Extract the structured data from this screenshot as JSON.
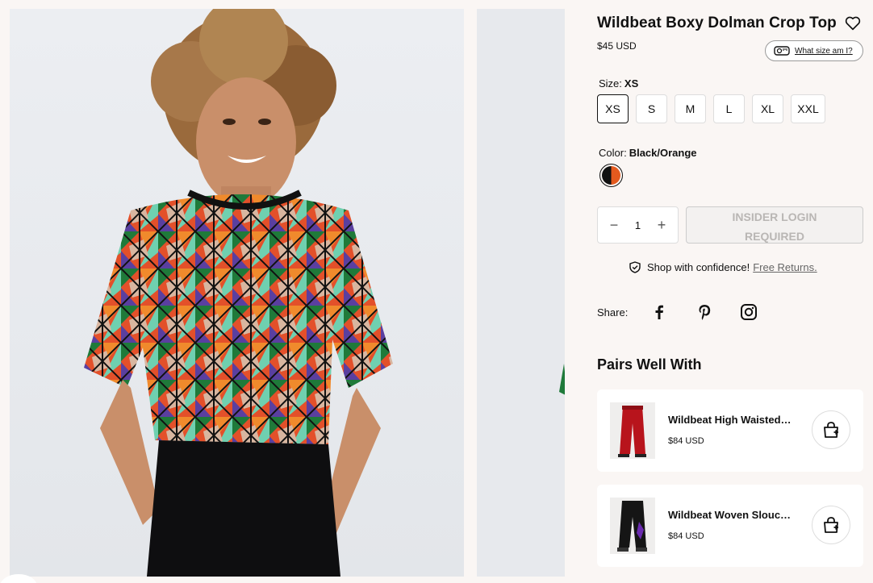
{
  "product": {
    "title": "Wildbeat Boxy Dolman Crop Top",
    "price": "$45 USD",
    "size_guide_label": "What size am I?"
  },
  "size": {
    "label": "Size:",
    "selected": "XS",
    "options": [
      "XS",
      "S",
      "M",
      "L",
      "XL",
      "XXL"
    ]
  },
  "color": {
    "label": "Color:",
    "selected": "Black/Orange",
    "swatch_colors": [
      "#111111",
      "#e45a1e"
    ]
  },
  "quantity": {
    "value": "1",
    "minus": "−",
    "plus": "+"
  },
  "cart_button": {
    "line1": "INSIDER LOGIN",
    "line2": "REQUIRED"
  },
  "confidence": {
    "text": "Shop with confidence!",
    "link": "Free Returns."
  },
  "share": {
    "label": "Share:",
    "icons": [
      "facebook-icon",
      "pinterest-icon",
      "instagram-icon"
    ]
  },
  "pairs": {
    "title": "Pairs Well With",
    "items": [
      {
        "name": "Wildbeat High Waisted…",
        "price": "$84 USD"
      },
      {
        "name": "Wildbeat Woven Slouc…",
        "price": "$84 USD"
      }
    ]
  },
  "colors": {
    "background": "#faf6f4",
    "accent": "#111111",
    "disabled_text": "#b9b6b4"
  }
}
